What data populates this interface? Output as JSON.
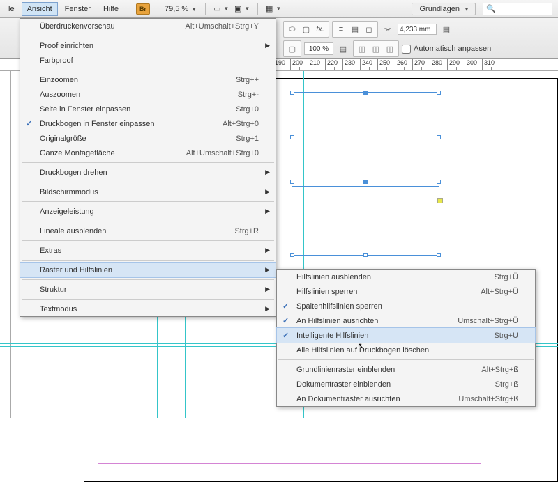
{
  "menubar": {
    "items": [
      "le",
      "Ansicht",
      "Fenster",
      "Hilfe"
    ],
    "br": "Br",
    "zoom": "79,5 %",
    "workspace": "Grundlagen"
  },
  "toolbar": {
    "pct": "100 %",
    "field": "4,233 mm",
    "autofit": "Automatisch anpassen"
  },
  "ruler_marks": [
    "190",
    "200",
    "210",
    "220",
    "230",
    "240",
    "250",
    "260",
    "270",
    "280",
    "290",
    "300",
    "310"
  ],
  "menu1": [
    {
      "label": "Überdruckenvorschau",
      "shortcut": "Alt+Umschalt+Strg+Y"
    },
    {
      "sep": true
    },
    {
      "label": "Proof einrichten",
      "sub": true
    },
    {
      "label": "Farbproof"
    },
    {
      "sep": true
    },
    {
      "label": "Einzoomen",
      "shortcut": "Strg++"
    },
    {
      "label": "Auszoomen",
      "shortcut": "Strg+-"
    },
    {
      "label": "Seite in Fenster einpassen",
      "shortcut": "Strg+0"
    },
    {
      "label": "Druckbogen in Fenster einpassen",
      "shortcut": "Alt+Strg+0",
      "checked": true
    },
    {
      "label": "Originalgröße",
      "shortcut": "Strg+1"
    },
    {
      "label": "Ganze Montagefläche",
      "shortcut": "Alt+Umschalt+Strg+0"
    },
    {
      "sep": true
    },
    {
      "label": "Druckbogen drehen",
      "sub": true
    },
    {
      "sep": true
    },
    {
      "label": "Bildschirmmodus",
      "sub": true
    },
    {
      "sep": true
    },
    {
      "label": "Anzeigeleistung",
      "sub": true
    },
    {
      "sep": true
    },
    {
      "label": "Lineale ausblenden",
      "shortcut": "Strg+R"
    },
    {
      "sep": true
    },
    {
      "label": "Extras",
      "sub": true
    },
    {
      "sep": true
    },
    {
      "label": "Raster und Hilfslinien",
      "sub": true,
      "hl": true
    },
    {
      "sep": true
    },
    {
      "label": "Struktur",
      "sub": true
    },
    {
      "sep": true
    },
    {
      "label": "Textmodus",
      "sub": true
    }
  ],
  "menu2": [
    {
      "label": "Hilfslinien ausblenden",
      "shortcut": "Strg+Ü"
    },
    {
      "label": "Hilfslinien sperren",
      "shortcut": "Alt+Strg+Ü"
    },
    {
      "label": "Spaltenhilfslinien sperren",
      "checked": true
    },
    {
      "label": "An Hilfslinien ausrichten",
      "shortcut": "Umschalt+Strg+Ü",
      "checked": true
    },
    {
      "label": "Intelligente Hilfslinien",
      "shortcut": "Strg+U",
      "checked": true,
      "hl": true
    },
    {
      "label": "Alle Hilfslinien auf Druckbogen löschen"
    },
    {
      "sep": true
    },
    {
      "label": "Grundlinienraster einblenden",
      "shortcut": "Alt+Strg+ß"
    },
    {
      "label": "Dokumentraster einblenden",
      "shortcut": "Strg+ß"
    },
    {
      "label": "An Dokumentraster ausrichten",
      "shortcut": "Umschalt+Strg+ß"
    }
  ]
}
